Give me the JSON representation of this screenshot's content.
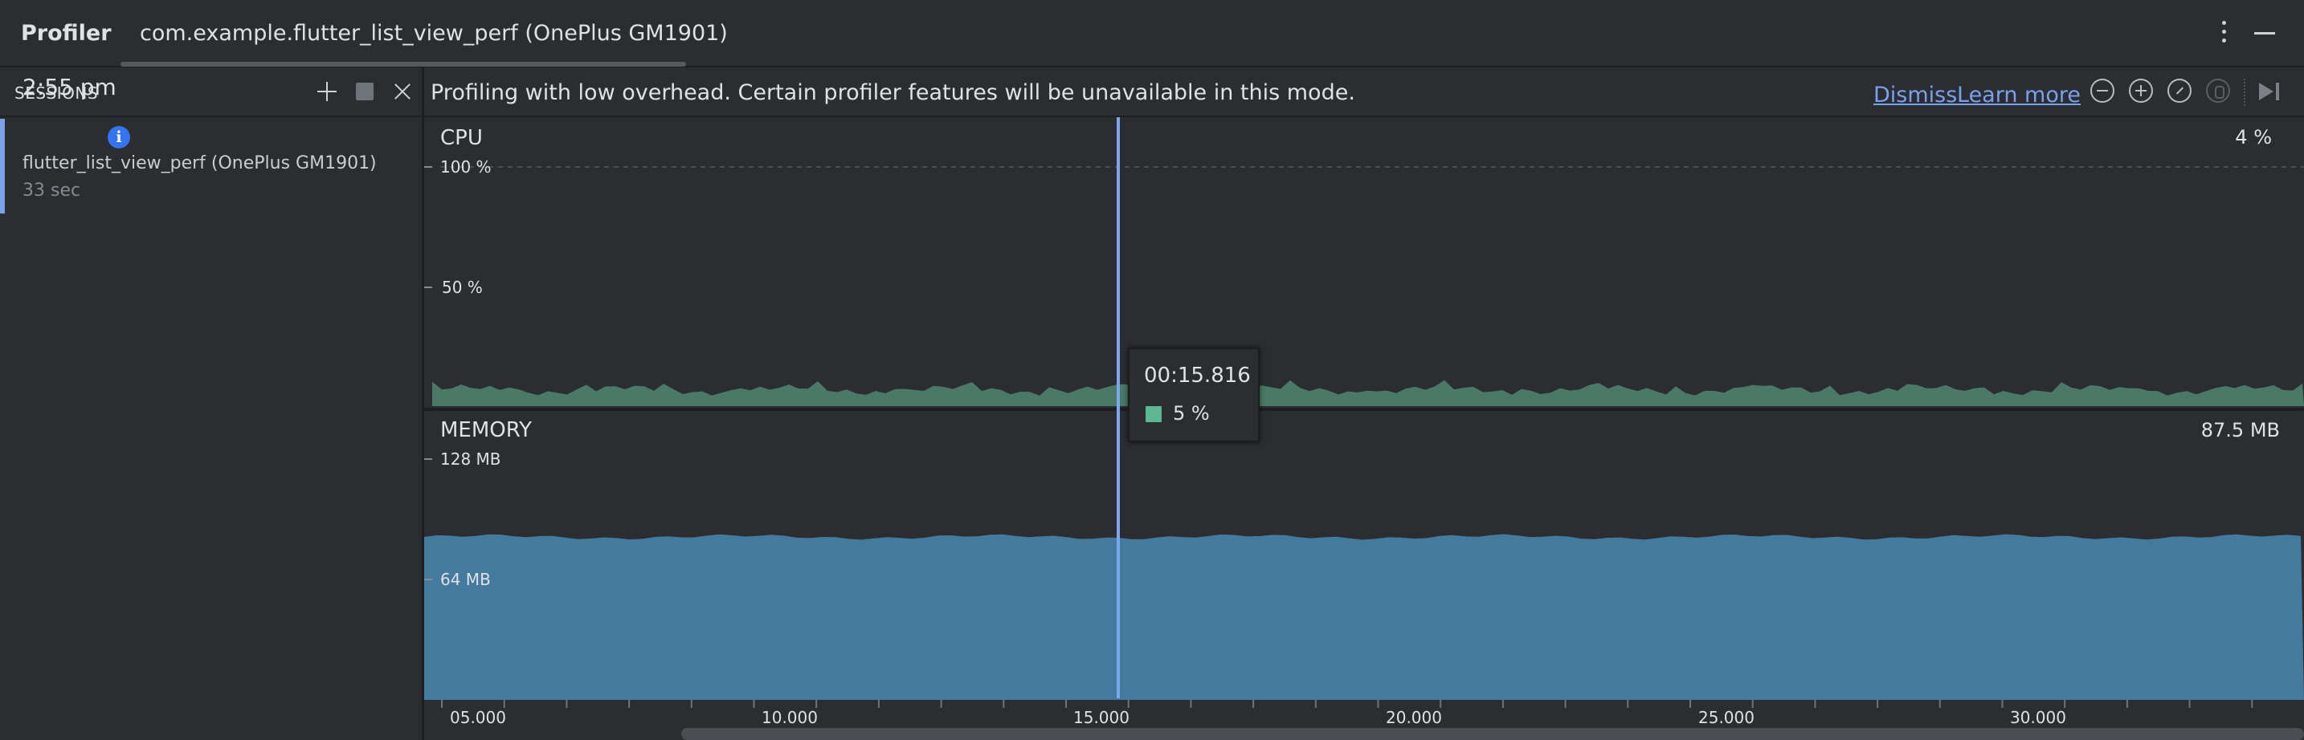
{
  "titlebar": {
    "app_name": "Profiler",
    "tab_title": "com.example.flutter_list_view_perf (OnePlus GM1901)",
    "menu_icon": "more-vertical-icon",
    "minimize_icon": "minimize-icon"
  },
  "sidebar": {
    "header_label": "SESSIONS",
    "icons": [
      "plus-icon",
      "stop-icon",
      "close-icon"
    ],
    "session": {
      "time": "2:55 pm",
      "info_icon": "i",
      "name": "flutter_list_view_perf (OnePlus GM1901)",
      "duration": "33 sec"
    }
  },
  "banner": {
    "message": "Profiling with low overhead. Certain profiler features will be unavailable in this mode.",
    "dismiss": "Dismiss",
    "learn_more": "Learn more"
  },
  "cpu": {
    "label": "CPU",
    "current": "4 %",
    "axis": [
      "100 %",
      "50 %"
    ],
    "color": "#4a7a67"
  },
  "memory": {
    "label": "MEMORY",
    "current": "87.5 MB",
    "axis": [
      "128 MB",
      "64 MB"
    ],
    "color": "#437a9e"
  },
  "timeline": {
    "labels": [
      "05.000",
      "10.000",
      "15.000",
      "20.000",
      "25.000",
      "30.000"
    ]
  },
  "tooltip": {
    "time": "00:15.816",
    "value": "5 %",
    "swatch_color": "#5fb694"
  },
  "accent_colors": {
    "cursor": "#7aa8f0",
    "link": "#7aa0f0",
    "session_accent": "#7aa0e8"
  }
}
